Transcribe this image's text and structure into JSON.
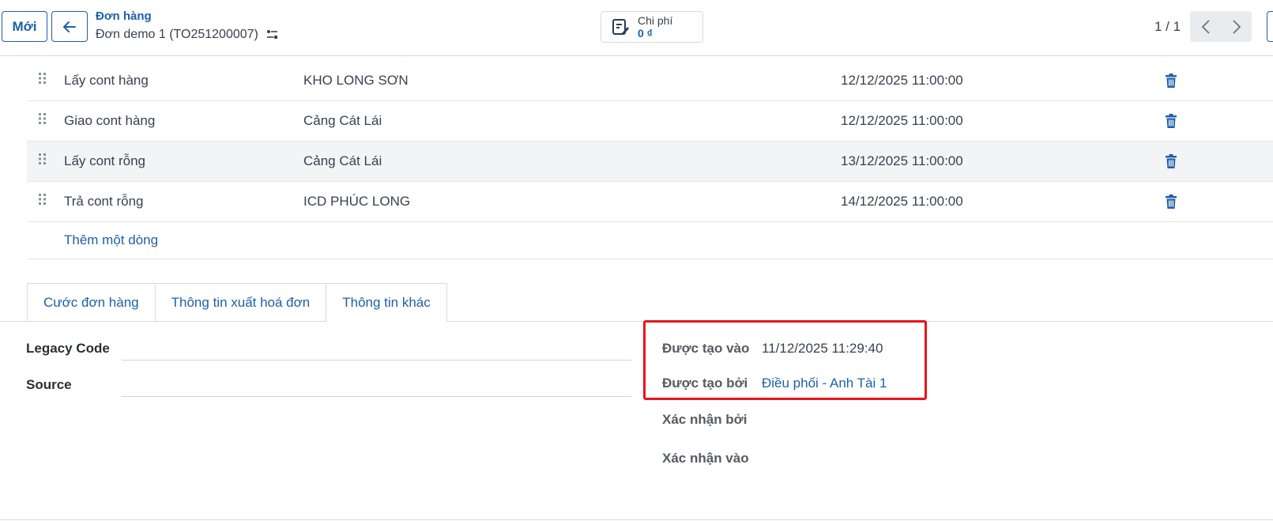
{
  "header": {
    "new_button": "Mới",
    "breadcrumb_parent": "Đơn hàng",
    "breadcrumb_current": "Đơn demo 1 (TO251200007)",
    "cost": {
      "label": "Chi phí",
      "value": "0 ₫"
    },
    "pager": "1 / 1"
  },
  "stops": [
    {
      "name": "Lấy cont hàng",
      "location": "KHO LONG SƠN",
      "time": "12/12/2025 11:00:00"
    },
    {
      "name": "Giao cont hàng",
      "location": "Cảng Cát Lái",
      "time": "12/12/2025 11:00:00"
    },
    {
      "name": "Lấy cont rỗng",
      "location": "Cảng Cát Lái",
      "time": "13/12/2025 11:00:00"
    },
    {
      "name": "Trả cont rỗng",
      "location": "ICD PHÚC LONG",
      "time": "14/12/2025 11:00:00"
    }
  ],
  "add_line": "Thêm một dòng",
  "tabs": [
    {
      "label": "Cước đơn hàng",
      "active": false
    },
    {
      "label": "Thông tin xuất hoá đơn",
      "active": false
    },
    {
      "label": "Thông tin khác",
      "active": true
    }
  ],
  "form": {
    "legacy_code_label": "Legacy Code",
    "legacy_code_value": "",
    "source_label": "Source",
    "source_value": ""
  },
  "info": {
    "created_on_label": "Được tạo vào",
    "created_on_value": "11/12/2025 11:29:40",
    "created_by_label": "Được tạo bởi",
    "created_by_value": "Điều phối - Anh Tài 1",
    "confirmed_by_label": "Xác nhận bởi",
    "confirmed_on_label": "Xác nhận vào"
  },
  "colors": {
    "accent": "#1f5fa8",
    "highlight_box": "#e8141c",
    "row_hover": "#f3f4f6"
  }
}
